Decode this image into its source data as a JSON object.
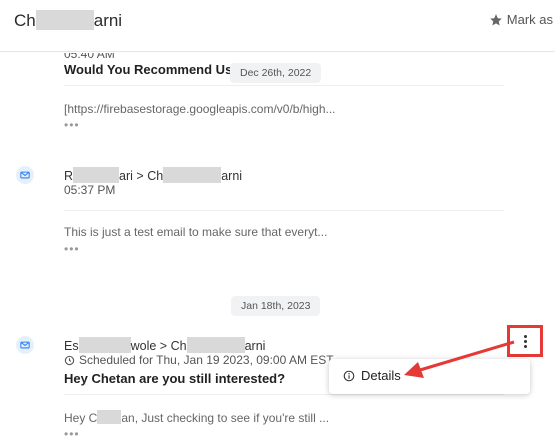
{
  "header": {
    "contact_prefix": "Ch",
    "contact_suffix": "arni",
    "mark_as_label": "Mark as",
    "mark_as_icon": "star-icon"
  },
  "thread": [
    {
      "time_partial": "05:40 AM",
      "subject": "Would You Recommend Us?",
      "date_chip": "Dec 26th, 2022",
      "preview": "[https://firebasestorage.googleapis.com/v0/b/high...",
      "ellipsis": "•••"
    },
    {
      "icon": "mail-icon",
      "from_prefix": "R",
      "from_suffix": "ari",
      "arrow": ">",
      "to_prefix": "Ch",
      "to_suffix": "arni",
      "time": "05:37 PM",
      "preview": "This is just a test email to make sure that everyt...",
      "ellipsis": "•••"
    },
    {
      "date_chip": "Jan 18th, 2023"
    },
    {
      "icon": "mail-icon",
      "from_prefix": "Es",
      "from_suffix": "wole",
      "arrow": ">",
      "to_prefix": "Ch",
      "to_suffix": "arni",
      "scheduled_icon": "clock-icon",
      "scheduled": "Scheduled for Thu, Jan 19 2023, 09:00 AM EST",
      "subject": "Hey Chetan are you still interested?",
      "preview_prefix": "Hey C",
      "preview_suffix": "an, Just checking to see if you're still ...",
      "ellipsis": "•••"
    }
  ],
  "menu": {
    "details_label": "Details",
    "details_icon": "info-icon"
  },
  "colors": {
    "annotation": "#e53935",
    "mail_icon": "#2d7ff9",
    "chip_bg": "#f1f2f4"
  }
}
